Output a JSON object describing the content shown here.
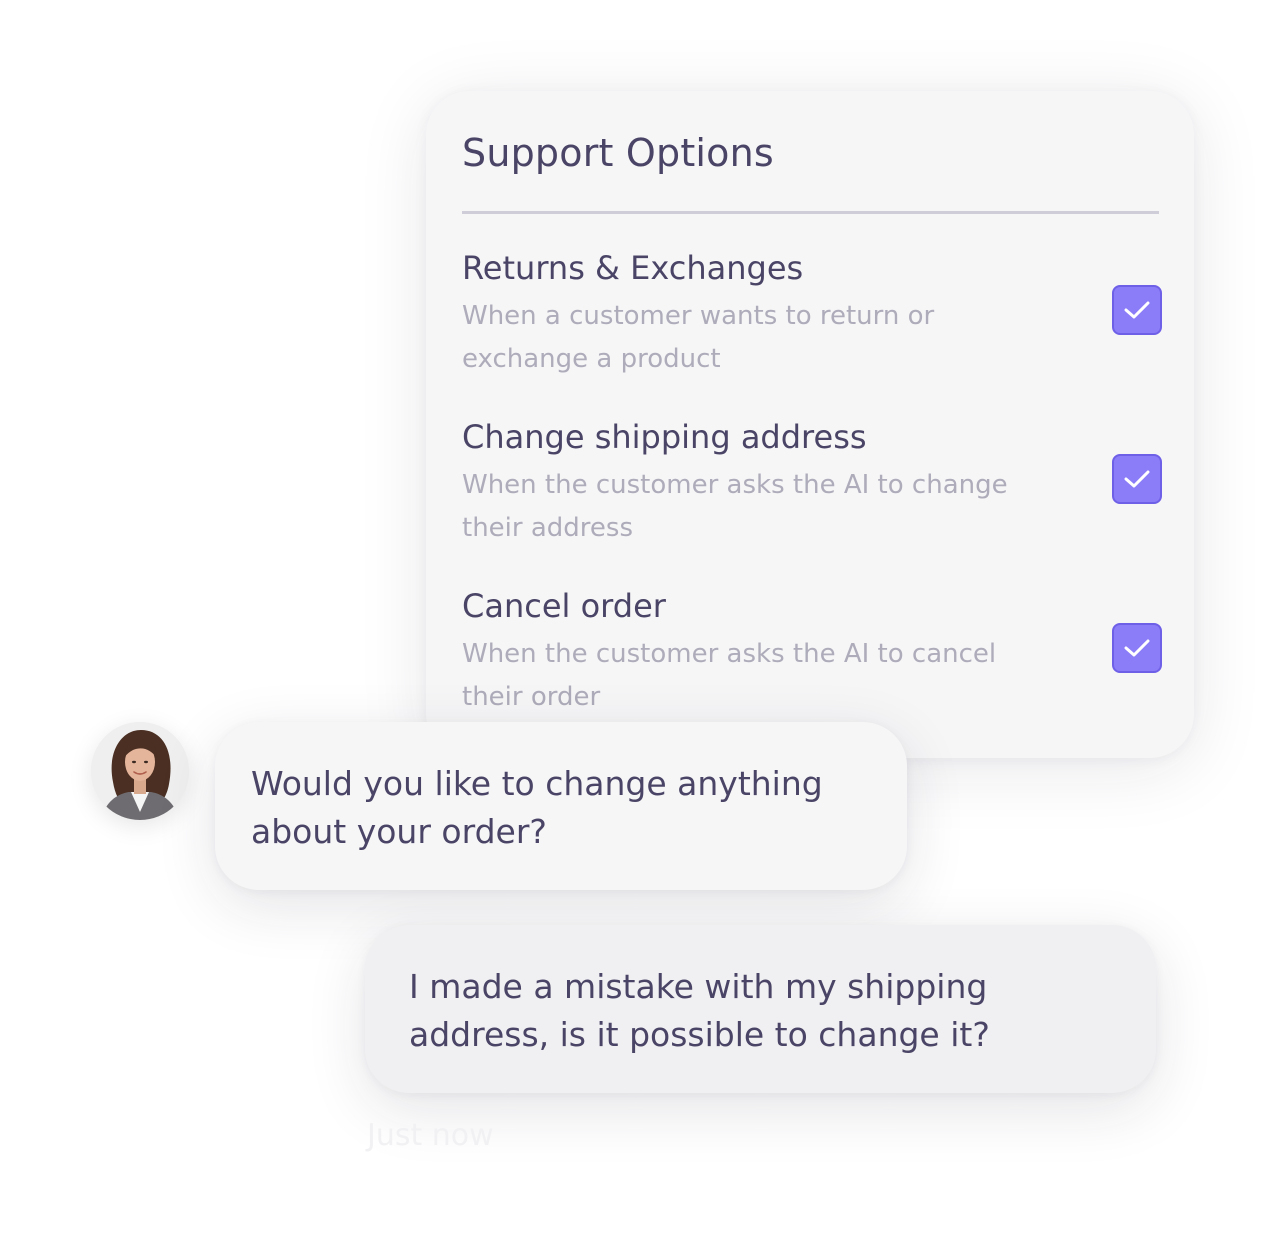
{
  "support_options": {
    "title": "Support Options",
    "options": [
      {
        "title": "Returns & Exchanges",
        "description": "When a customer wants to return or exchange a product",
        "checked": true,
        "checkbox_icon": "check-icon"
      },
      {
        "title": "Change shipping address",
        "description": "When the customer asks the AI to change their address",
        "checked": true,
        "checkbox_icon": "check-icon"
      },
      {
        "title": "Cancel order",
        "description": "When the customer asks the AI to cancel their order",
        "checked": true,
        "checkbox_icon": "check-icon"
      }
    ],
    "checkbox_color": "#8b7cf7"
  },
  "chat": {
    "agent_message": "Would you like to change anything about your order?",
    "user_message": "I made a mistake with my shipping address, is it possible to change it?",
    "timestamp": "Just now",
    "agent_avatar_icon": "agent-avatar"
  },
  "colors": {
    "text_primary": "#4a4566",
    "text_secondary": "#aeacba",
    "accent": "#8b7cf7"
  }
}
